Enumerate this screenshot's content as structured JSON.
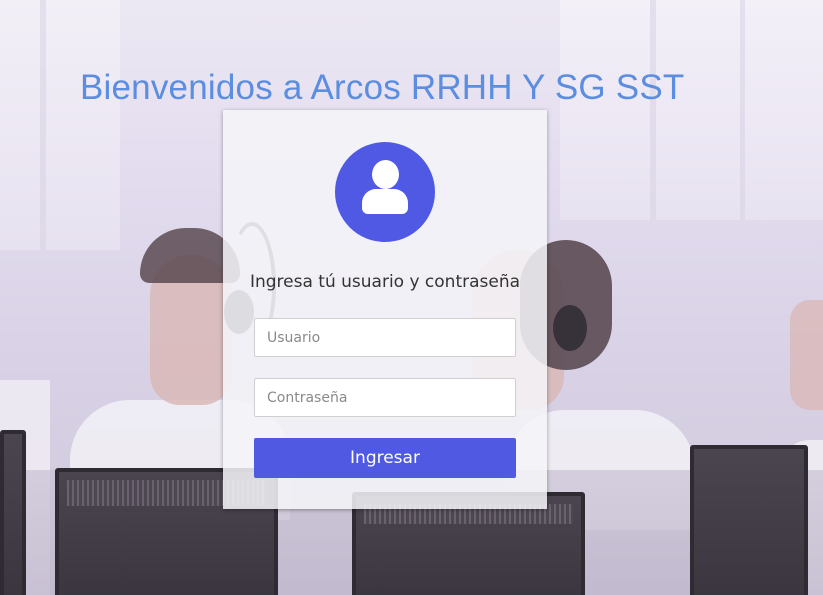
{
  "welcome": {
    "title": "Bienvenidos a Arcos RRHH Y SG SST"
  },
  "login": {
    "avatar_icon": "user-icon",
    "heading": "Ingresa tú usuario y contraseña",
    "username_placeholder": "Usuario",
    "password_placeholder": "Contraseña",
    "submit_label": "Ingresar"
  },
  "colors": {
    "title": "#5b8de0",
    "accent": "#4f59e2",
    "card_background": "#f5f4f8"
  }
}
